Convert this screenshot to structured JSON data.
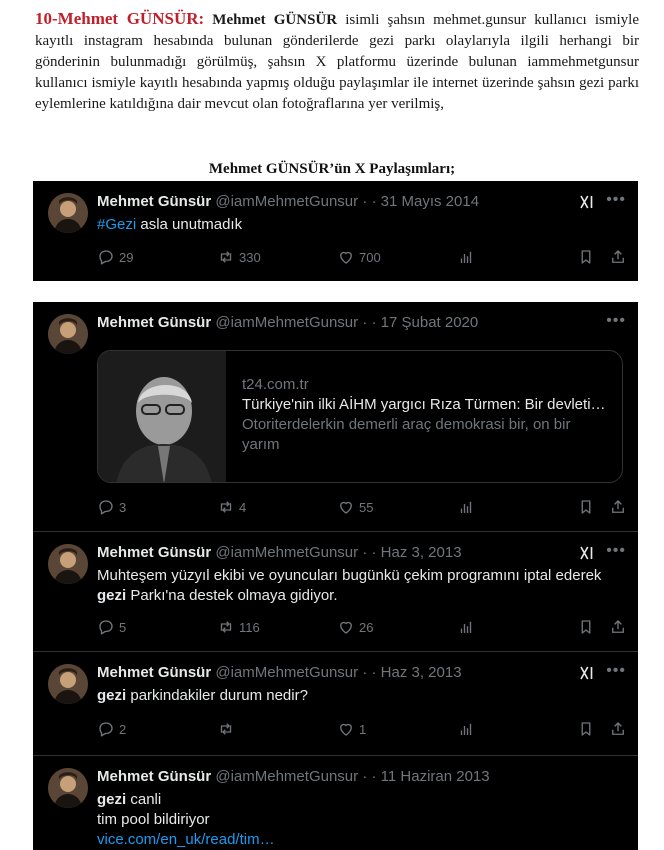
{
  "document": {
    "heading_number": "10-Mehmet GÜNSÜR:",
    "heading_name": "Mehmet GÜNSÜR",
    "paragraph_rest": " isimli şahsın mehmet.gunsur kullanıcı ismiyle kayıtlı instagram hesabında bulunan gönderilerde gezi parkı olaylarıyla ilgili herhangi bir gönderinin bulunmadığı görülmüş, şahsın X platformu üzerinde bulunan iammehmetgunsur kullanıcı ismiyle kayıtlı hesabında yapmış olduğu paylaşımlar ile internet üzerinde şahsın gezi parkı eylemlerine katıldığına dair mevcut olan fotoğraflarına yer verilmiş,",
    "section_title": "Mehmet GÜNSÜR’ün X Paylaşımları;"
  },
  "author": {
    "name": "Mehmet Günsür",
    "handle": "@iamMehmetGunsur",
    "separator": "· ·"
  },
  "tweets": [
    {
      "date": "31 Mayıs 2014",
      "hashtag": "#Gezi",
      "text": " asla unutmadık",
      "replies": "29",
      "reposts": "330",
      "likes": "700"
    },
    {
      "date": "17 Şubat 2020",
      "card": {
        "domain": "t24.com.tr",
        "title": "Türkiye'nin ilki AİHM yargıcı Rıza Türmen: Bir devleti…",
        "description": "Otoriterdelerkin demerli araç demokrasi bir, on bir yarım"
      },
      "replies": "3",
      "reposts": "4",
      "likes": "55"
    },
    {
      "date": "Haz 3, 2013",
      "text_line1": "Muhteşem yüzyıl ekibi ve oyuncuları bugünkü çekim programını iptal ederek",
      "text_bold": "gezi",
      "text_line2": " Parkı'na destek olmaya gidiyor.",
      "replies": "5",
      "reposts": "116",
      "likes": "26"
    },
    {
      "date": "Haz 3, 2013",
      "text_bold": "gezi",
      "text": " parkindakiler durum nedir?",
      "replies": "2",
      "reposts": "",
      "likes": "1"
    },
    {
      "date": "11 Haziran 2013",
      "text_bold": "gezi",
      "text": " canli",
      "text_line2": " tim pool bildiriyor",
      "link": "vice.com/en_uk/read/tim…"
    }
  ],
  "icons": [
    "grok-icon",
    "more-icon",
    "reply-icon",
    "repost-icon",
    "like-icon",
    "views-icon",
    "bookmark-icon",
    "share-icon"
  ],
  "colors": {
    "heading_red": "#c0202a",
    "tweet_bg": "#000000",
    "link_blue": "#1d9bf0",
    "muted_gray": "#71767b",
    "text_white": "#e7e9ea"
  }
}
